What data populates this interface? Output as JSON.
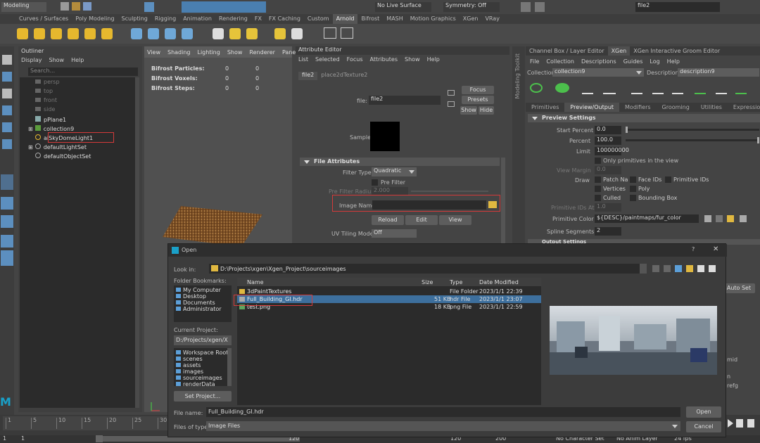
{
  "status_line": {
    "mode": "Modeling",
    "live_surface": "No Live Surface",
    "symmetry": "Symmetry: Off",
    "search_value": "file2"
  },
  "shelf_tabs": [
    "Curves / Surfaces",
    "Poly Modeling",
    "Sculpting",
    "Rigging",
    "Animation",
    "Rendering",
    "FX",
    "FX Caching",
    "Custom",
    "Arnold",
    "Bifrost",
    "MASH",
    "Motion Graphics",
    "XGen",
    "VRay"
  ],
  "outliner": {
    "title": "Outliner",
    "menus": [
      "Display",
      "Show",
      "Help"
    ],
    "search_placeholder": "Search...",
    "items": [
      "persp",
      "top",
      "front",
      "side",
      "pPlane1",
      "collection9",
      "aiSkyDomeLight1",
      "defaultLightSet",
      "defaultObjectSet"
    ]
  },
  "viewport": {
    "menus": [
      "View",
      "Shading",
      "Lighting",
      "Show",
      "Renderer",
      "Panels"
    ],
    "stats": [
      {
        "label": "Bifrost Particles:",
        "a": "0",
        "b": "0"
      },
      {
        "label": "Bifrost Voxels:",
        "a": "0",
        "b": "0"
      },
      {
        "label": "Bifrost Steps:",
        "a": "0",
        "b": "0"
      }
    ]
  },
  "attribute_editor": {
    "title": "Attribute Editor",
    "menus": [
      "List",
      "Selected",
      "Focus",
      "Attributes",
      "Show",
      "Help"
    ],
    "tabs": [
      "file2",
      "place2dTexture2"
    ],
    "file_label": "file:",
    "file_value": "file2",
    "focus": "Focus",
    "presets": "Presets",
    "show": "Show",
    "hide": "Hide",
    "sample_label": "Sample",
    "section": "File Attributes",
    "filter_type_label": "Filter Type",
    "filter_type_value": "Quadratic",
    "pre_filter_label": "Pre Filter",
    "pre_filter_radius_label": "Pre Filter Radius",
    "pre_filter_radius_value": "2.000",
    "image_name_label": "Image Name",
    "reload": "Reload",
    "edit": "Edit",
    "view": "View",
    "uv_tiling_label": "UV Tiling Mode",
    "uv_tiling_value": "Off"
  },
  "modeling_toolkit": "Modeling Toolkit",
  "channel_box": {
    "tabs": [
      "Channel Box / Layer Editor",
      "XGen",
      "XGen Interactive Groom Editor"
    ],
    "menus": [
      "File",
      "Collection",
      "Descriptions",
      "Guides",
      "Log",
      "Help"
    ],
    "collection_label": "Collection",
    "collection_value": "collection9",
    "description_label": "Description",
    "description_value": "description9",
    "subtabs": [
      "Primitives",
      "Preview/Output",
      "Modifiers",
      "Grooming",
      "Utilities",
      "Expressions"
    ],
    "section": "Preview Settings",
    "start_percent_label": "Start Percent",
    "start_percent": "0.0",
    "percent_label": "Percent",
    "percent": "100.0",
    "limit_label": "Limit",
    "limit": "100000000",
    "only_primitives": "Only primitives in the view",
    "view_margin_label": "View Margin",
    "view_margin": "0.0",
    "draw_label": "Draw",
    "draw_options": [
      "Patch Na",
      "Face IDs",
      "Primitive IDs",
      "Vertices",
      "Poly",
      "Culled",
      "Bounding Box"
    ],
    "primitive_ids_label": "Primitive IDs At",
    "primitive_ids": "1.0",
    "primitive_color_label": "Primitive Color",
    "primitive_color": "${DESC}/paintmaps/fur_color",
    "spline_segments_label": "Spline Segments",
    "spline_segments": "2",
    "output_settings": "Output Settings",
    "auto_set": "Auto Set",
    "partial": [
      "mid",
      "n",
      "refg"
    ]
  },
  "open_dialog": {
    "title": "Open",
    "look_in_label": "Look in:",
    "look_in": "D:\\Projects\\xgen\\Xgen_Project\\sourceimages",
    "bookmarks_label": "Folder Bookmarks:",
    "bookmarks": [
      "My Computer",
      "Desktop",
      "Documents",
      "Administrator"
    ],
    "current_project_label": "Current Project:",
    "current_project": "D:/Projects/xgen/X",
    "project_folders": [
      "Workspace Root",
      "scenes",
      "assets",
      "images",
      "sourceimages",
      "renderData"
    ],
    "set_project": "Set Project...",
    "columns": [
      "Name",
      "Size",
      "Type",
      "Date Modified"
    ],
    "files": [
      {
        "name": "3dPaintTextures",
        "size": "",
        "type": "File Folder",
        "date": "2023/1/1 22:39"
      },
      {
        "name": "Full_Building_GI.hdr",
        "size": "51 KB",
        "type": "hdr File",
        "date": "2023/1/1 23:07"
      },
      {
        "name": "test.png",
        "size": "18 KB",
        "type": "png File",
        "date": "2023/1/1 22:59"
      }
    ],
    "file_name_label": "File name:",
    "file_name": "Full_Building_GI.hdr",
    "files_of_type_label": "Files of type:",
    "files_of_type": "Image Files",
    "open_btn": "Open",
    "cancel_btn": "Cancel"
  },
  "timeline": {
    "ticks": [
      "1",
      "5",
      "10",
      "15",
      "20",
      "25",
      "30"
    ],
    "range": [
      "1",
      "1",
      "1",
      "120",
      "120",
      "200"
    ],
    "no_character_set": "No Character Set",
    "no_anim_layer": "No Anim Layer",
    "fps": "24 fps"
  }
}
